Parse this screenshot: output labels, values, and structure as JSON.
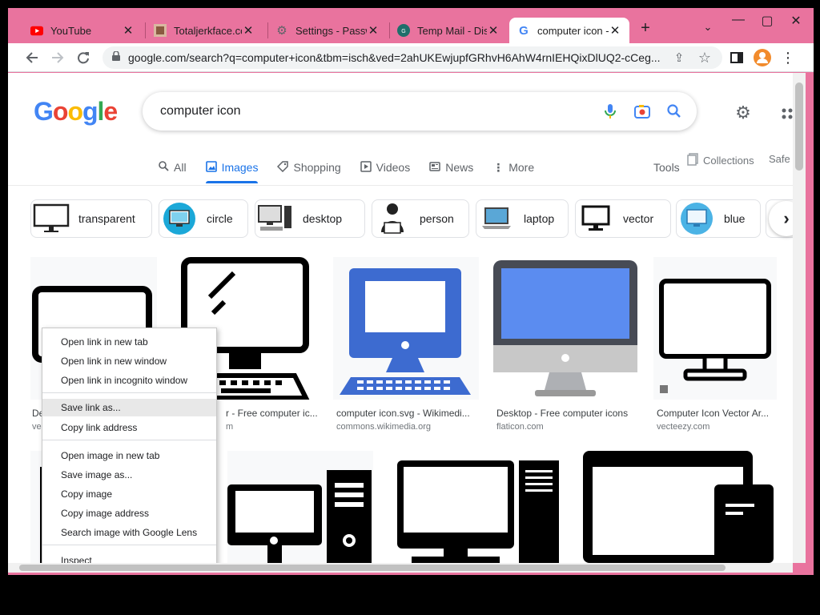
{
  "tabs": [
    {
      "title": "YouTube",
      "icon": "youtube-icon"
    },
    {
      "title": "Totaljerkface.co",
      "icon": "site-favicon-icon"
    },
    {
      "title": "Settings - Passw",
      "icon": "gear-icon"
    },
    {
      "title": "Temp Mail - Disp",
      "icon": "tempmail-icon"
    },
    {
      "title": "computer icon -",
      "icon": "google-g-icon"
    }
  ],
  "address_bar": {
    "url": "google.com/search?q=computer+icon&tbm=isch&ved=2ahUKEwjupfGRhvH6AhW4rnIEHQixDlUQ2-cCeg..."
  },
  "search": {
    "query": "computer icon"
  },
  "nav_tabs": [
    {
      "label": "All",
      "icon": "search-icon"
    },
    {
      "label": "Images",
      "icon": "image-icon",
      "active": true
    },
    {
      "label": "Shopping",
      "icon": "tag-icon"
    },
    {
      "label": "Videos",
      "icon": "play-icon"
    },
    {
      "label": "News",
      "icon": "newspaper-icon"
    },
    {
      "label": "More",
      "icon": "kebab-icon"
    }
  ],
  "tools_label": "Tools",
  "collections_label": "Collections",
  "safe_label": "Safe",
  "chips": [
    {
      "label": "transparent"
    },
    {
      "label": "circle"
    },
    {
      "label": "desktop"
    },
    {
      "label": "person"
    },
    {
      "label": "laptop"
    },
    {
      "label": "vector"
    },
    {
      "label": "blue"
    }
  ],
  "results": [
    {
      "caption": "De",
      "source": "ve"
    },
    {
      "caption": "r - Free computer ic...",
      "source": "m"
    },
    {
      "caption": "computer icon.svg - Wikimedi...",
      "source": "commons.wikimedia.org"
    },
    {
      "caption": "Desktop - Free computer icons",
      "source": "flaticon.com"
    },
    {
      "caption": "Computer Icon Vector Ar...",
      "source": "vecteezy.com"
    }
  ],
  "context_menu": {
    "items": [
      "Open link in new tab",
      "Open link in new window",
      "Open link in incognito window",
      "Save link as...",
      "Copy link address",
      "Open image in new tab",
      "Save image as...",
      "Copy image",
      "Copy image address",
      "Search image with Google Lens",
      "Inspect"
    ],
    "highlighted": "Save link as..."
  },
  "colors": {
    "window_frame": "#e9739e",
    "google_blue": "#4285f4",
    "google_red": "#ea4335",
    "google_yellow": "#fbbc05",
    "google_green": "#34a853",
    "monitor_blue": "#3d6bd0"
  }
}
